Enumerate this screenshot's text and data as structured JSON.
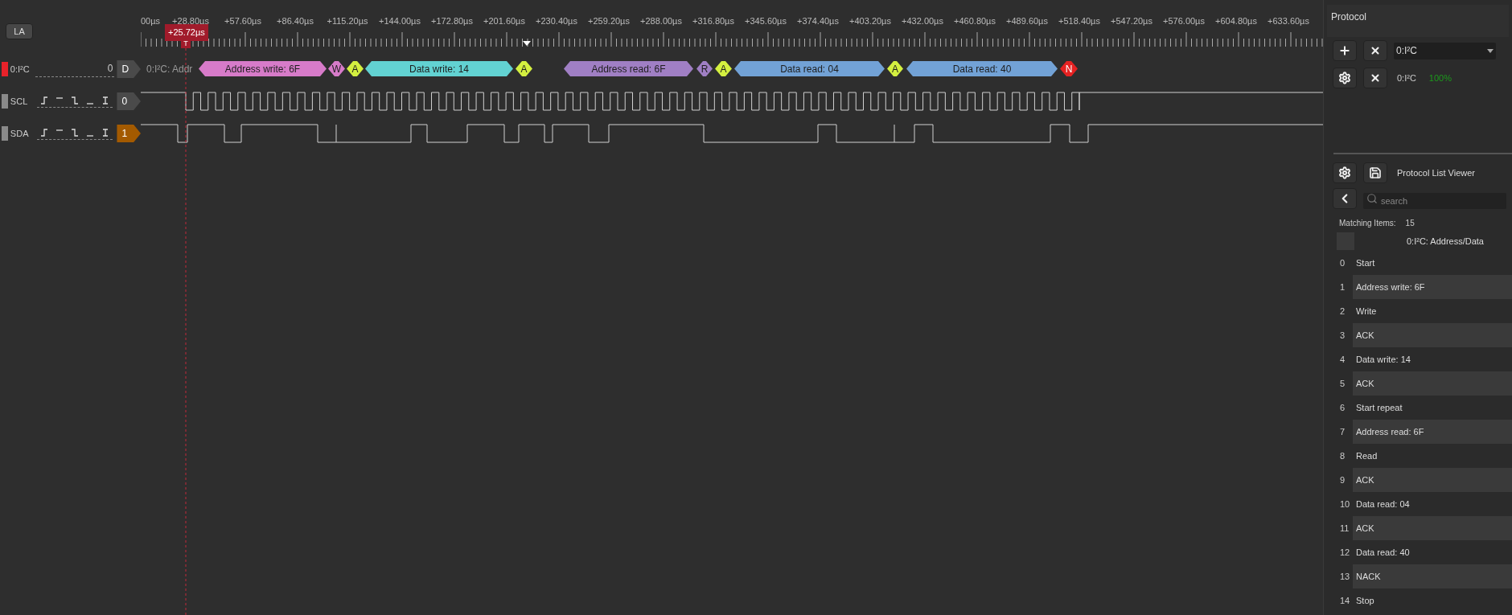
{
  "toolbar": {
    "button": "LA"
  },
  "ruler": {
    "labels": [
      "00µs",
      "+28.80µs",
      "+57.60µs",
      "+86.40µs",
      "+115.20µs",
      "+144.00µs",
      "+172.80µs",
      "+201.60µs",
      "+230.40µs",
      "+259.20µs",
      "+288.00µs",
      "+316.80µs",
      "+345.60µs",
      "+374.40µs",
      "+403.20µs",
      "+432.00µs",
      "+460.80µs",
      "+489.60µs",
      "+518.40µs",
      "+547.20µs",
      "+576.00µs",
      "+604.80µs",
      "+633.60µs"
    ],
    "cursor": "+25.72µs",
    "trigger": "T"
  },
  "channels": [
    {
      "kind": "decoder",
      "name": "0:I²C",
      "value": "0",
      "color": "#e8222a",
      "tag": {
        "text": "D",
        "color": "#4a4a4a"
      }
    },
    {
      "kind": "logic",
      "name": "SCL",
      "color": "#8a8a8a",
      "tag": {
        "text": "0",
        "color": "#4a4a4a"
      }
    },
    {
      "kind": "logic",
      "name": "SDA",
      "color": "#8a8a8a",
      "tag": {
        "text": "1",
        "color": "#a35a00"
      }
    }
  ],
  "decoder_row": {
    "label": "0:I²C: Addr",
    "annotations": [
      {
        "label": "Address write: 6F",
        "color": "#d77bc9"
      },
      {
        "label": "W",
        "color": "#d77bc9"
      },
      {
        "label": "A",
        "color": "#d4f040"
      },
      {
        "label": "Data write: 14",
        "color": "#62d2d2"
      },
      {
        "label": "A",
        "color": "#d4f040"
      },
      {
        "label": "Address read: 6F",
        "color": "#a07fc4"
      },
      {
        "label": "R",
        "color": "#a07fc4"
      },
      {
        "label": "A",
        "color": "#d4f040"
      },
      {
        "label": "Data read: 04",
        "color": "#72a2d6"
      },
      {
        "label": "A",
        "color": "#d4f040"
      },
      {
        "label": "Data read: 40",
        "color": "#72a2d6"
      },
      {
        "label": "N",
        "color": "#e52222"
      }
    ]
  },
  "protocol_panel": {
    "title": "Protocol",
    "selector": "0:I²C",
    "decoders": [
      {
        "name": "0:I²C",
        "status": "100%",
        "complete": true
      }
    ]
  },
  "list_viewer": {
    "title": "Protocol List Viewer",
    "search_placeholder": "search",
    "matching_label": "Matching Items:",
    "matching_count": "15",
    "column": "0:I²C: Address/Data",
    "rows": [
      {
        "index": "0",
        "text": "Start"
      },
      {
        "index": "1",
        "text": "Address write: 6F"
      },
      {
        "index": "2",
        "text": "Write"
      },
      {
        "index": "3",
        "text": "ACK"
      },
      {
        "index": "4",
        "text": "Data write: 14"
      },
      {
        "index": "5",
        "text": "ACK"
      },
      {
        "index": "6",
        "text": "Start repeat"
      },
      {
        "index": "7",
        "text": "Address read: 6F"
      },
      {
        "index": "8",
        "text": "Read"
      },
      {
        "index": "9",
        "text": "ACK"
      },
      {
        "index": "10",
        "text": "Data read: 04"
      },
      {
        "index": "11",
        "text": "ACK"
      },
      {
        "index": "12",
        "text": "Data read: 40"
      },
      {
        "index": "13",
        "text": "NACK"
      },
      {
        "index": "14",
        "text": "Stop"
      }
    ]
  }
}
